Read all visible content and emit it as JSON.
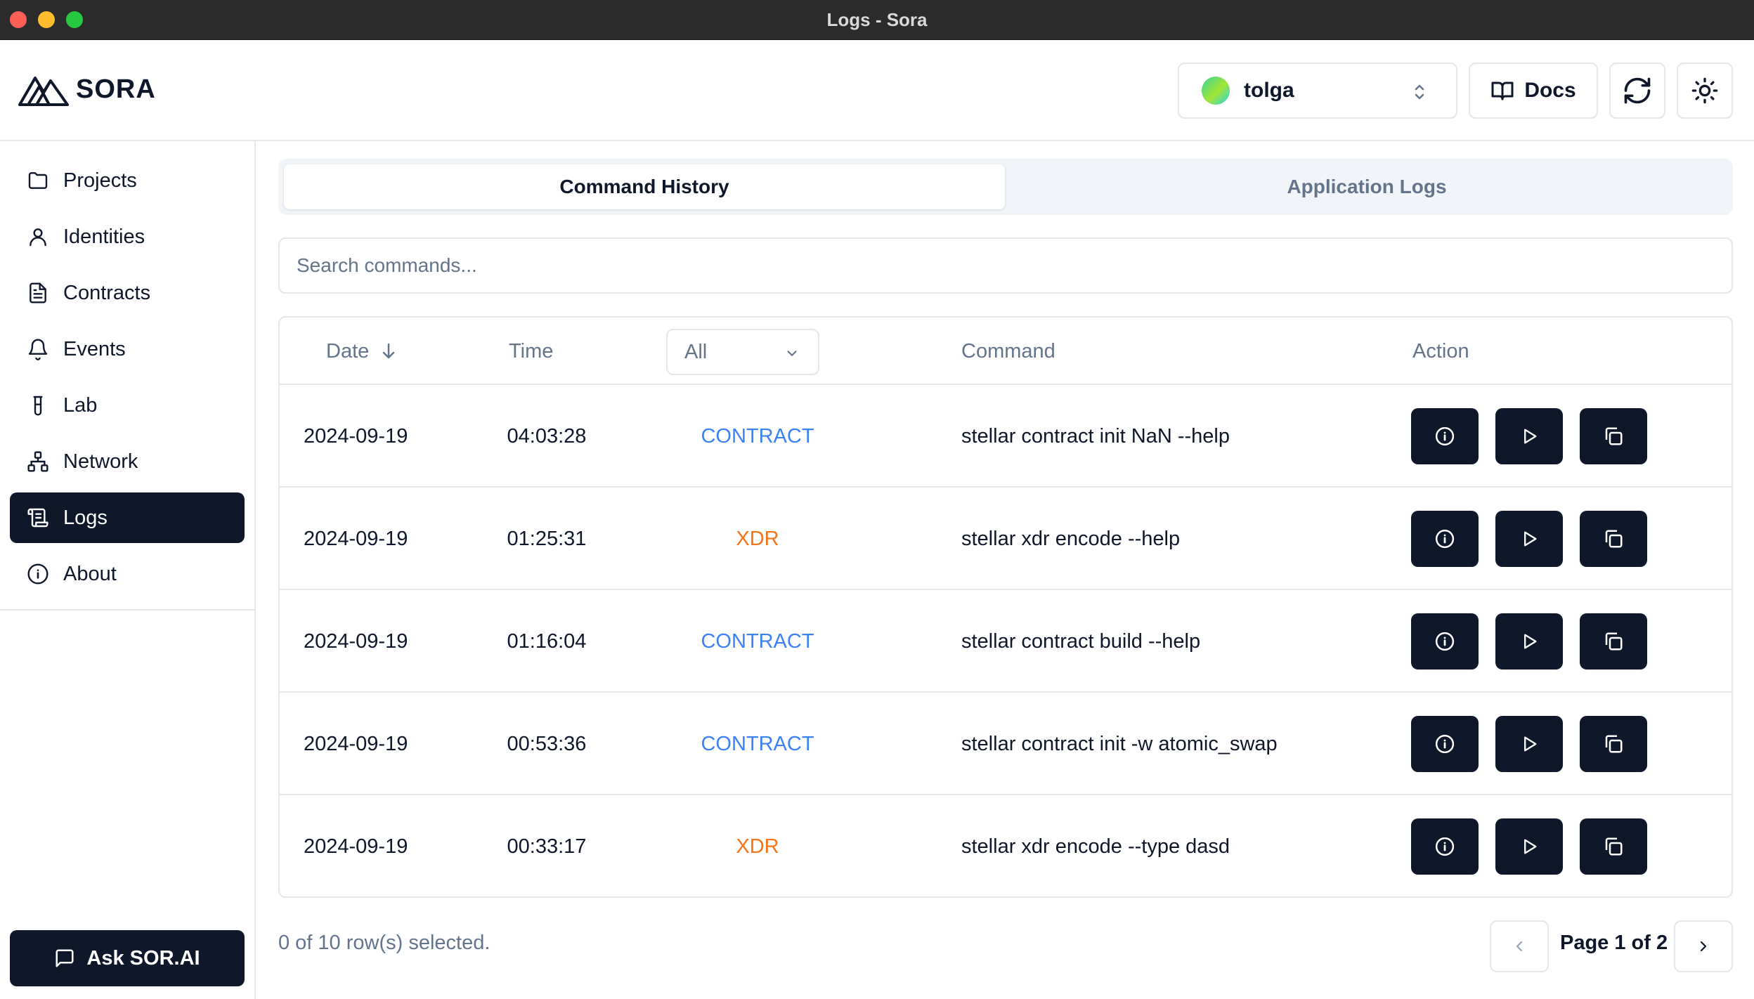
{
  "window": {
    "title": "Logs - Sora"
  },
  "header": {
    "logo_text": "SORA",
    "profile_name": "tolga",
    "docs_label": "Docs"
  },
  "sidebar": {
    "items": [
      {
        "label": "Projects",
        "icon": "folder-icon"
      },
      {
        "label": "Identities",
        "icon": "user-icon"
      },
      {
        "label": "Contracts",
        "icon": "file-text-icon"
      },
      {
        "label": "Events",
        "icon": "bell-icon"
      },
      {
        "label": "Lab",
        "icon": "test-tube-icon"
      },
      {
        "label": "Network",
        "icon": "network-icon"
      },
      {
        "label": "Logs",
        "icon": "scroll-text-icon",
        "active": true
      },
      {
        "label": "About",
        "icon": "info-icon"
      }
    ],
    "ask_label": "Ask SOR.AI"
  },
  "tabs": [
    {
      "label": "Command History",
      "active": true
    },
    {
      "label": "Application Logs",
      "active": false
    }
  ],
  "search": {
    "placeholder": "Search commands...",
    "value": ""
  },
  "table": {
    "headers": {
      "date": "Date",
      "time": "Time",
      "filter": "All",
      "command": "Command",
      "action": "Action"
    },
    "rows": [
      {
        "date": "2024-09-19",
        "time": "04:03:28",
        "type": "CONTRACT",
        "command": "stellar contract init NaN --help"
      },
      {
        "date": "2024-09-19",
        "time": "01:25:31",
        "type": "XDR",
        "command": "stellar xdr encode --help"
      },
      {
        "date": "2024-09-19",
        "time": "01:16:04",
        "type": "CONTRACT",
        "command": "stellar contract build --help"
      },
      {
        "date": "2024-09-19",
        "time": "00:53:36",
        "type": "CONTRACT",
        "command": "stellar contract init -w atomic_swap"
      },
      {
        "date": "2024-09-19",
        "time": "00:33:17",
        "type": "XDR",
        "command": "stellar xdr encode --type dasd"
      }
    ]
  },
  "footer": {
    "selection_text": "0 of 10 row(s) selected.",
    "page_label": "Page 1 of 2"
  },
  "colors": {
    "primary": "#0f172a",
    "contract": "#3b82f6",
    "xdr": "#f97316",
    "muted": "#64748b",
    "border": "#e5e7eb"
  }
}
